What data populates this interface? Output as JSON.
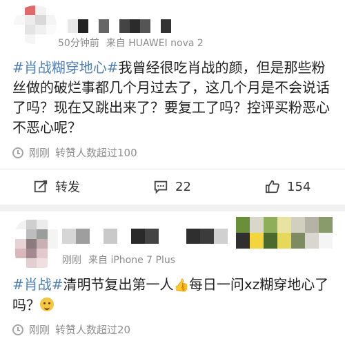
{
  "post1": {
    "username_hidden": true,
    "meta": {
      "time": "50分钟前",
      "source_prefix": "来自",
      "device": "HUAWEI nova 2"
    },
    "content": {
      "hashtag": "#肖战糊穿地心#",
      "text": "我曾经很吃肖战的颜，但是那些粉丝做的破烂事都几个月过去了，这几个月是不会说话了吗？现在又跳出来了？要复工了吗？控评买粉恶心不恶心呢？"
    },
    "sub_meta": {
      "time": "刚刚",
      "repost_info": "转赞人数超过100"
    },
    "actions": {
      "repost_label": "转发",
      "comment_count": "22",
      "like_count": "154"
    },
    "icons": {
      "repost": "edit-share-icon",
      "comment": "comment-bubble-icon",
      "like": "thumbs-up-icon",
      "clock": "clock-icon"
    }
  },
  "post2": {
    "username_hidden": true,
    "meta": {
      "time": "刚刚",
      "source_prefix": "来自",
      "device": "iPhone 7 Plus"
    },
    "content": {
      "hashtag": "#肖战#",
      "text_a": "清明节复出第一人",
      "emoji_hand": "👍",
      "text_b": "每日一问xz糊穿地心了吗？",
      "emoji_face": "face-emoji"
    },
    "sub_meta": {
      "time": "刚刚",
      "repost_info": "转赞人数超过20"
    }
  },
  "colors": {
    "link": "#4f7fb3",
    "meta": "#8b8b8b",
    "separator": "#f1f1f1"
  }
}
